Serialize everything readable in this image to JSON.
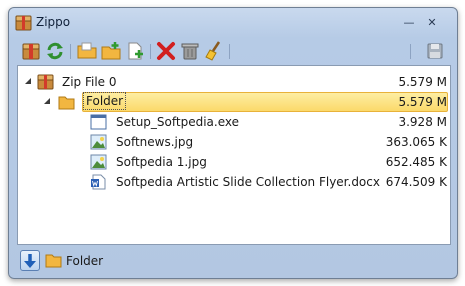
{
  "window": {
    "title": "Zippo",
    "minimize_glyph": "—",
    "close_glyph": "✕"
  },
  "toolbar": {
    "buttons": [
      {
        "name": "extract-archive-button",
        "icon": "archive-icon"
      },
      {
        "name": "refresh-button",
        "icon": "refresh-arrows-icon"
      },
      {
        "name": "open-folder-button",
        "icon": "open-folder-icon"
      },
      {
        "name": "add-folder-button",
        "icon": "folder-add-icon"
      },
      {
        "name": "add-file-button",
        "icon": "file-add-icon"
      },
      {
        "name": "delete-button",
        "icon": "red-x-icon"
      },
      {
        "name": "trash-button",
        "icon": "trash-can-icon"
      },
      {
        "name": "clean-button",
        "icon": "broom-icon"
      },
      {
        "name": "save-button",
        "icon": "disk-icon"
      }
    ]
  },
  "tree": {
    "root": {
      "name": "Zip File 0",
      "size": "5.579 M",
      "icon": "zip-archive-icon"
    },
    "folder": {
      "name": "Folder",
      "size": "5.579 M",
      "icon": "folder-icon",
      "selected": true
    },
    "files": [
      {
        "name": "Setup_Softpedia.exe",
        "size": "3.928 M",
        "icon": "exe-file-icon"
      },
      {
        "name": "Softnews.jpg",
        "size": "363.065 K",
        "icon": "image-file-icon"
      },
      {
        "name": "Softpedia 1.jpg",
        "size": "652.485 K",
        "icon": "image-file-icon"
      },
      {
        "name": "Softpedia Artistic Slide Collection Flyer.docx",
        "size": "674.509 K",
        "icon": "word-doc-icon"
      }
    ]
  },
  "statusbar": {
    "current_folder": "Folder"
  },
  "colors": {
    "selection": "#fbd96a",
    "frame": "#b6cbe6"
  }
}
